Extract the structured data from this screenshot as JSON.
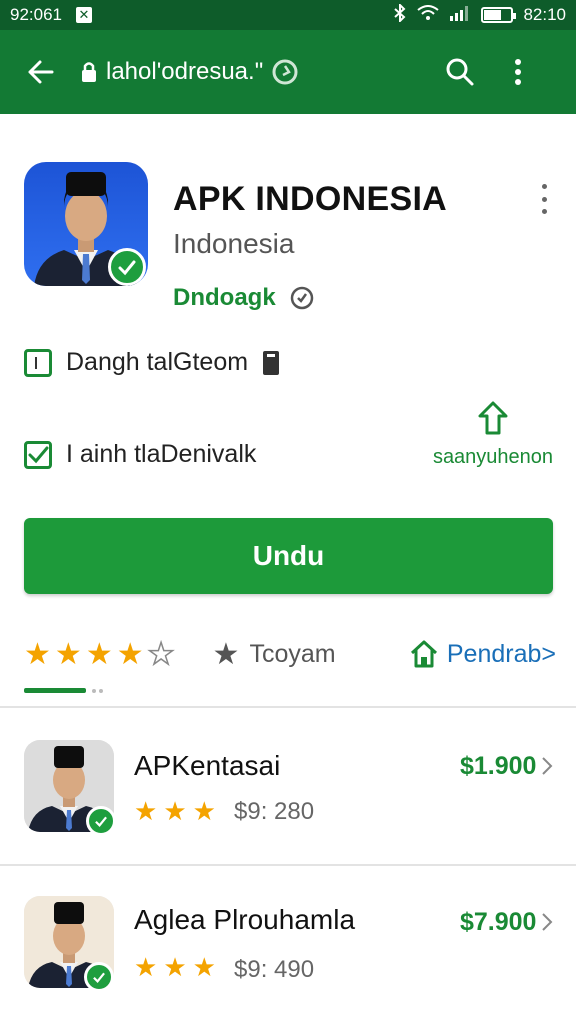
{
  "status_bar": {
    "left_time": "92:061",
    "right_time": "82:10",
    "battery_level": 0.65
  },
  "app_bar": {
    "url_text": "lahol'odresua.\""
  },
  "app": {
    "title": "APK INDONESIA",
    "subtitle": "Indonesia",
    "developer": "Dndoagk",
    "option_1": "Dangh talGteom",
    "option_2": "I ainh tlaDenivalk",
    "share_label": "saanyuhenon",
    "install_label": "Undu",
    "rating": 4,
    "rating_max": 5,
    "category_label": "Tcoyam",
    "link_label": "Pendrab>"
  },
  "list": [
    {
      "title": "APKentasai",
      "stars": 3,
      "meta": "$9: 280",
      "price": "$1.900"
    },
    {
      "title": "Aglea Plrouhamla",
      "stars": 3,
      "meta": "$9: 490",
      "price": "$7.900"
    }
  ],
  "colors": {
    "status_bar": "#0e5c2a",
    "app_bar": "#137a34",
    "accent_green": "#1d9a3a",
    "link_blue": "#1a6fb8",
    "star_gold": "#f4a300"
  },
  "icons": {
    "back": "arrow-left-icon",
    "lock": "lock-icon",
    "search": "search-icon",
    "menu": "more-vert-icon",
    "verified": "check-badge-icon",
    "share": "share-upload-icon",
    "home": "home-icon"
  }
}
